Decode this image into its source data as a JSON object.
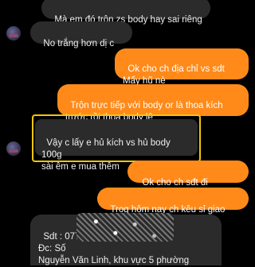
{
  "messages": [
    {
      "id": "m1",
      "text": "Mà em đó trộn zs body hay sai riêng"
    },
    {
      "id": "m2",
      "text": "No trắng hơn dị c"
    },
    {
      "id": "m3",
      "text": "Ok cho ch địa chỉ vs sdt\nMấy hũ nè"
    },
    {
      "id": "m4",
      "text": "Trộn trực tiếp với body or là thoa kích\ntrước rồi thoa body lê"
    },
    {
      "id": "m5",
      "text": "Vậy c lấy e hủ kích vs hủ body 100g\nsài êm e mua thêm"
    },
    {
      "id": "m6",
      "text": "Ok cho ch sđt đi"
    },
    {
      "id": "m7_a",
      "text": "Trog "
    },
    {
      "id": "m7_b",
      "text": "hôm nay"
    },
    {
      "id": "m7_c",
      "text": " ch kêu sỉ giao"
    },
    {
      "id": "m8",
      "text": "Sdt : 077 ‌ ‌ ‌ ‌ ‌ ‌ ‌ ‌4\nĐc: Số\nNguyễn Văn Linh, khu vực 5 phường"
    }
  ],
  "colors": {
    "incoming": "#2b2b2b",
    "outgoing": "#ff8a1a",
    "highlight": "#f3c60a"
  }
}
